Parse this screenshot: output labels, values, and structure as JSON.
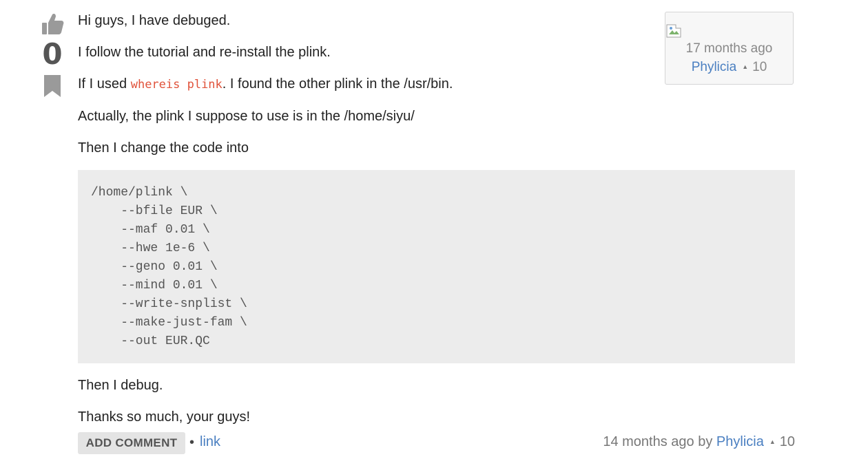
{
  "vote": {
    "score": "0",
    "upvote_icon": "thumbs-up-icon",
    "bookmark_icon": "bookmark-icon"
  },
  "user_card": {
    "avatar_icon": "broken-image-icon",
    "time": "17 months ago",
    "username": "Phylicia",
    "reputation": "10"
  },
  "post": {
    "p1": "Hi guys, I have debuged.",
    "p2": "I follow the tutorial and re-install the plink.",
    "p3_before": "If I used ",
    "p3_code": "whereis plink",
    "p3_after": ". I found the other plink in the /usr/bin.",
    "p4": "Actually, the plink I suppose to use is in the /home/siyu/",
    "p5": "Then I change the code into",
    "code": "/home/plink \\\n    --bfile EUR \\\n    --maf 0.01 \\\n    --hwe 1e-6 \\\n    --geno 0.01 \\\n    --mind 0.01 \\\n    --write-snplist \\\n    --make-just-fam \\\n    --out EUR.QC",
    "p6": "Then I debug.",
    "p7": "Thanks so much, your guys!"
  },
  "footer": {
    "add_comment": "ADD COMMENT",
    "bullet": "•",
    "link": "link",
    "time_text": "14 months ago by ",
    "username": "Phylicia",
    "reputation": "10"
  },
  "colors": {
    "link": "#4a7fc1",
    "inline_code": "#e0523a",
    "code_bg": "#ececec",
    "muted": "#888888"
  }
}
